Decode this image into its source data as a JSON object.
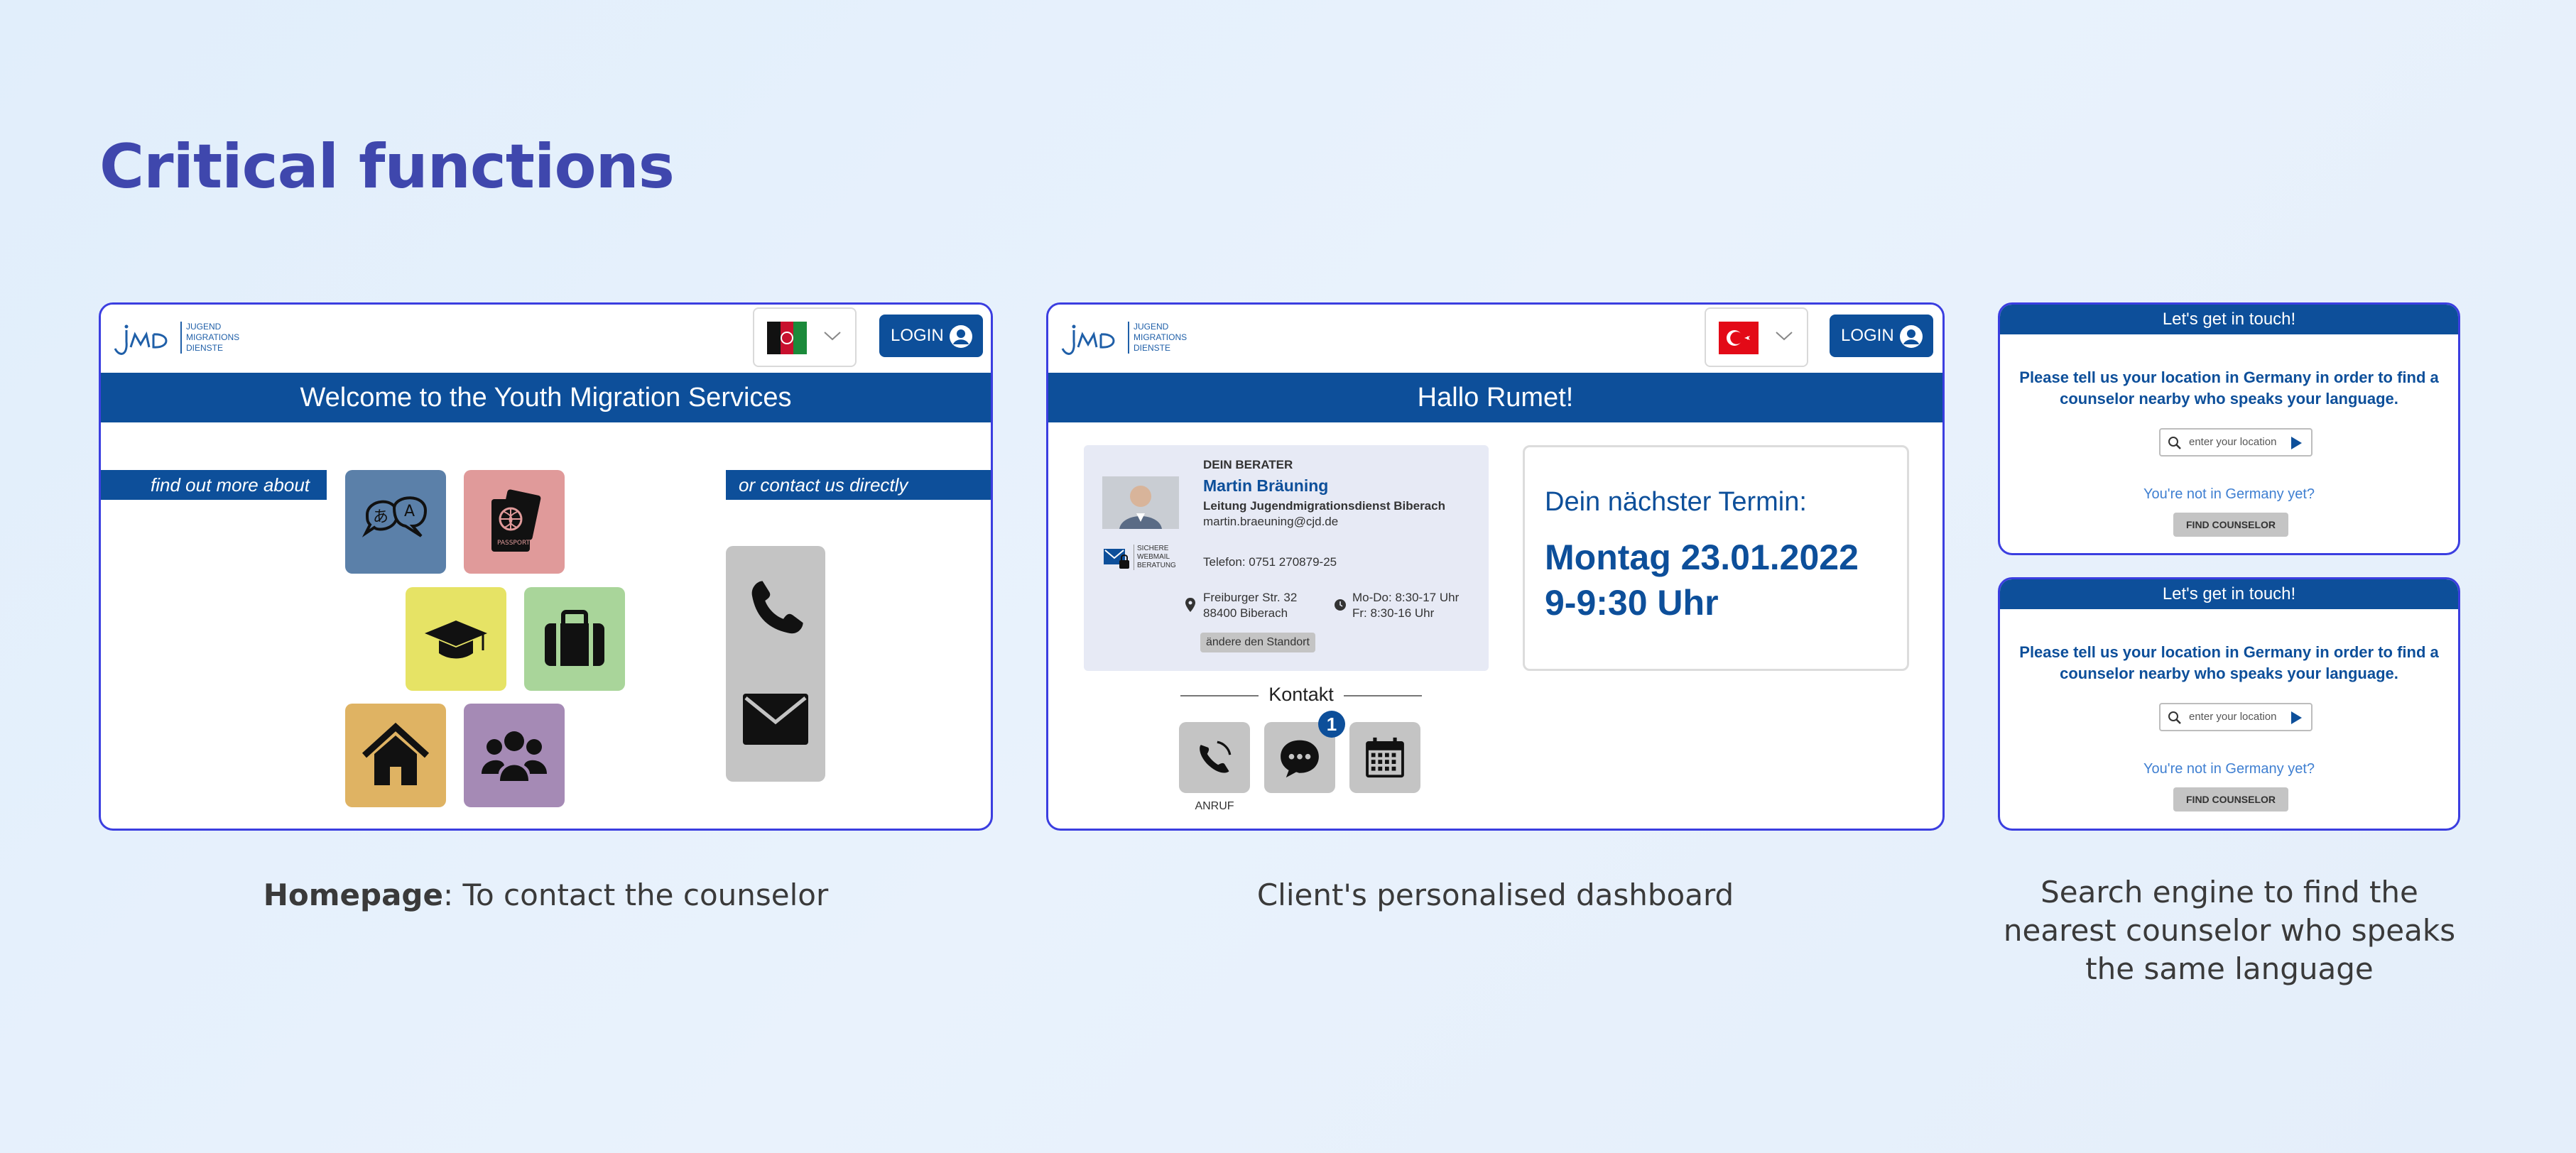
{
  "page": {
    "title": "Critical functions"
  },
  "homepage": {
    "logo": {
      "line1": "JUGEND",
      "line2": "MIGRATIONS",
      "line3": "DIENSTE"
    },
    "login_label": "LOGIN",
    "banner": "Welcome to the Youth Migration Services",
    "find_out_label": "find out more about",
    "contact_label": "or contact us directly",
    "flag": "afghanistan-flag",
    "tiles": [
      {
        "icon": "translate-icon",
        "color": "#5b80a9"
      },
      {
        "icon": "passport-icon",
        "color": "#e09a9a"
      },
      {
        "icon": "graduation-cap-icon",
        "color": "#e6e365"
      },
      {
        "icon": "briefcase-icon",
        "color": "#a9d59a"
      },
      {
        "icon": "house-icon",
        "color": "#dfb363"
      },
      {
        "icon": "people-icon",
        "color": "#a58ab5"
      }
    ]
  },
  "dashboard": {
    "logo": {
      "line1": "JUGEND",
      "line2": "MIGRATIONS",
      "line3": "DIENSTE"
    },
    "login_label": "LOGIN",
    "flag": "turkey-flag",
    "greeting": "Hallo Rumet!",
    "advisor": {
      "heading": "DEIN BERATER",
      "name": "Martin Bräuning",
      "role": "Leitung Jugendmigrationsdienst Biberach",
      "email": "martin.braeuning@cjd.de",
      "webmail_line1": "SICHERE",
      "webmail_line2": "WEBMAIL",
      "webmail_line3": "BERATUNG",
      "phone": "Telefon: 0751  270879-25",
      "address_line1": "Freiburger Str. 32",
      "address_line2": "88400 Biberach",
      "hours_line1": "Mo-Do: 8:30-17 Uhr",
      "hours_line2": "Fr: 8:30-16 Uhr",
      "change_location": "ändere den Standort"
    },
    "appointment": {
      "label": "Dein nächster Termin:",
      "date": "Montag 23.01.2022",
      "time": "9-9:30 Uhr"
    },
    "kontakt_label": "Kontakt",
    "call_label": "ANRUF",
    "chat_badge": "1"
  },
  "search": {
    "panels": [
      {
        "header": "Let's get in touch!",
        "message": "Please tell us your location in Germany in order to find a counselor nearby who speaks your language.",
        "placeholder": "enter your location",
        "not_in_germany": "You're not in Germany yet?",
        "button": "FIND COUNSELOR"
      },
      {
        "header": "Let's get in touch!",
        "message": "Please tell us your location in Germany in order to find a counselor nearby who speaks your language.",
        "placeholder": "enter your location",
        "not_in_germany": "You're not in Germany yet?",
        "button": "FIND COUNSELOR"
      }
    ]
  },
  "captions": {
    "homepage_bold": "Homepage",
    "homepage_rest": ": To contact the counselor",
    "dashboard": "Client's personalised dashboard",
    "search_line1": "Search engine to find the",
    "search_line2": "nearest counselor who speaks",
    "search_line3": "the same language"
  }
}
